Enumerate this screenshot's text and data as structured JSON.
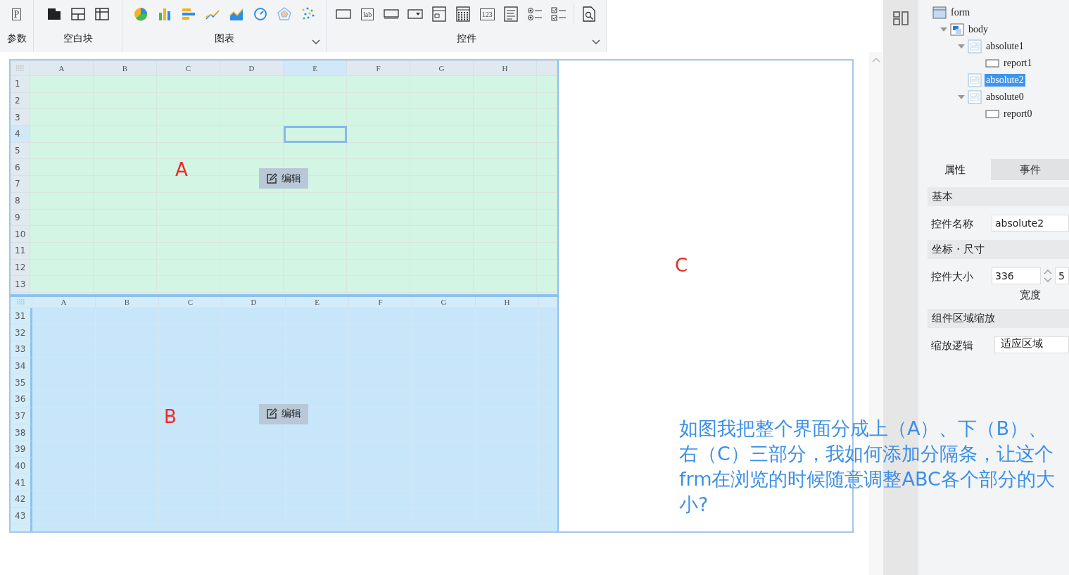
{
  "toolbar": {
    "groups": [
      {
        "label": "参数",
        "dropdown": false,
        "tools": [
          {
            "kind": "glyph",
            "glyph": "P"
          }
        ]
      },
      {
        "label": "空白块",
        "dropdown": false,
        "tools": [
          {
            "kind": "block"
          },
          {
            "kind": "split"
          },
          {
            "kind": "table"
          }
        ]
      },
      {
        "label": "图表",
        "dropdown": true,
        "tools": [
          {
            "kind": "pie"
          },
          {
            "kind": "bar"
          },
          {
            "kind": "hbar"
          },
          {
            "kind": "line"
          },
          {
            "kind": "area"
          },
          {
            "kind": "gauge"
          },
          {
            "kind": "radar"
          },
          {
            "kind": "scatter"
          }
        ]
      },
      {
        "label": "控件",
        "dropdown": true,
        "tools": [
          {
            "kind": "button"
          },
          {
            "kind": "textbox",
            "glyph": "lab"
          },
          {
            "kind": "input"
          },
          {
            "kind": "combo"
          },
          {
            "kind": "date"
          },
          {
            "kind": "calendar"
          },
          {
            "kind": "textbox",
            "glyph": "123"
          },
          {
            "kind": "list"
          },
          {
            "kind": "radio"
          },
          {
            "kind": "checkbox"
          },
          {
            "kind": "preview"
          }
        ]
      }
    ]
  },
  "sheets": [
    {
      "kind": "top",
      "marker": "A",
      "edit_button": "编辑",
      "columns": [
        {
          "label": "A",
          "selected": false
        },
        {
          "label": "B",
          "selected": false
        },
        {
          "label": "C",
          "selected": false
        },
        {
          "label": "D",
          "selected": false
        },
        {
          "label": "E",
          "selected": true
        },
        {
          "label": "F",
          "selected": false
        },
        {
          "label": "G",
          "selected": false
        },
        {
          "label": "H",
          "selected": false
        }
      ],
      "rows": [
        {
          "label": "1",
          "selected": false
        },
        {
          "label": "2",
          "selected": false
        },
        {
          "label": "3",
          "selected": false
        },
        {
          "label": "4",
          "selected": true
        },
        {
          "label": "5",
          "selected": false
        },
        {
          "label": "6",
          "selected": false
        },
        {
          "label": "7",
          "selected": false
        },
        {
          "label": "8",
          "selected": false
        },
        {
          "label": "9",
          "selected": false
        },
        {
          "label": "10",
          "selected": false
        },
        {
          "label": "11",
          "selected": false
        },
        {
          "label": "12",
          "selected": false
        },
        {
          "label": "13",
          "selected": false
        }
      ]
    },
    {
      "kind": "bottom",
      "marker": "B",
      "edit_button": "编辑",
      "columns": [
        {
          "label": "A",
          "selected": false
        },
        {
          "label": "B",
          "selected": false
        },
        {
          "label": "C",
          "selected": false
        },
        {
          "label": "D",
          "selected": false
        },
        {
          "label": "E",
          "selected": false
        },
        {
          "label": "F",
          "selected": false
        },
        {
          "label": "G",
          "selected": false
        },
        {
          "label": "H",
          "selected": false
        }
      ],
      "rows": [
        {
          "label": "31",
          "selected": false
        },
        {
          "label": "32",
          "selected": false
        },
        {
          "label": "33",
          "selected": false
        },
        {
          "label": "34",
          "selected": false
        },
        {
          "label": "35",
          "selected": false
        },
        {
          "label": "36",
          "selected": false
        },
        {
          "label": "37",
          "selected": false
        },
        {
          "label": "38",
          "selected": false
        },
        {
          "label": "39",
          "selected": false
        },
        {
          "label": "40",
          "selected": false
        },
        {
          "label": "41",
          "selected": false
        },
        {
          "label": "42",
          "selected": false
        },
        {
          "label": "43",
          "selected": false
        }
      ]
    }
  ],
  "right_pane": {
    "marker": "C"
  },
  "annotation": "如图我把整个界面分成上（A）、下（B）、右（C）三部分，我如何添加分隔条，让这个frm在浏览的时候随意调整ABC各个部分的大小?",
  "tree": [
    {
      "label": "form",
      "kind": "form",
      "selected": false,
      "children": [
        {
          "label": "body",
          "kind": "body",
          "selected": false,
          "expanded": true,
          "children": [
            {
              "label": "absolute1",
              "kind": "absolute",
              "selected": false,
              "expanded": true,
              "children": [
                {
                  "label": "report1",
                  "kind": "report",
                  "selected": false
                }
              ]
            },
            {
              "label": "absolute2",
              "kind": "absolute",
              "selected": true
            },
            {
              "label": "absolute0",
              "kind": "absolute",
              "selected": false,
              "expanded": true,
              "children": [
                {
                  "label": "report0",
                  "kind": "report",
                  "selected": false
                }
              ]
            }
          ]
        }
      ]
    }
  ],
  "properties": {
    "tabs": [
      {
        "label": "属性",
        "selected": true
      },
      {
        "label": "事件",
        "selected": false
      }
    ],
    "sections": [
      {
        "title": "基本",
        "fields": [
          {
            "kind": "text",
            "label": "控件名称",
            "value": "absolute2"
          }
        ]
      },
      {
        "title": "坐标・尺寸",
        "fields": [
          {
            "kind": "spinner",
            "label": "控件大小",
            "value": "336",
            "caption": "宽度",
            "value_2": "5"
          }
        ]
      },
      {
        "title": "组件区域缩放",
        "fields": [
          {
            "kind": "select",
            "label": "缩放逻辑",
            "value": "适应区域"
          }
        ]
      }
    ]
  }
}
